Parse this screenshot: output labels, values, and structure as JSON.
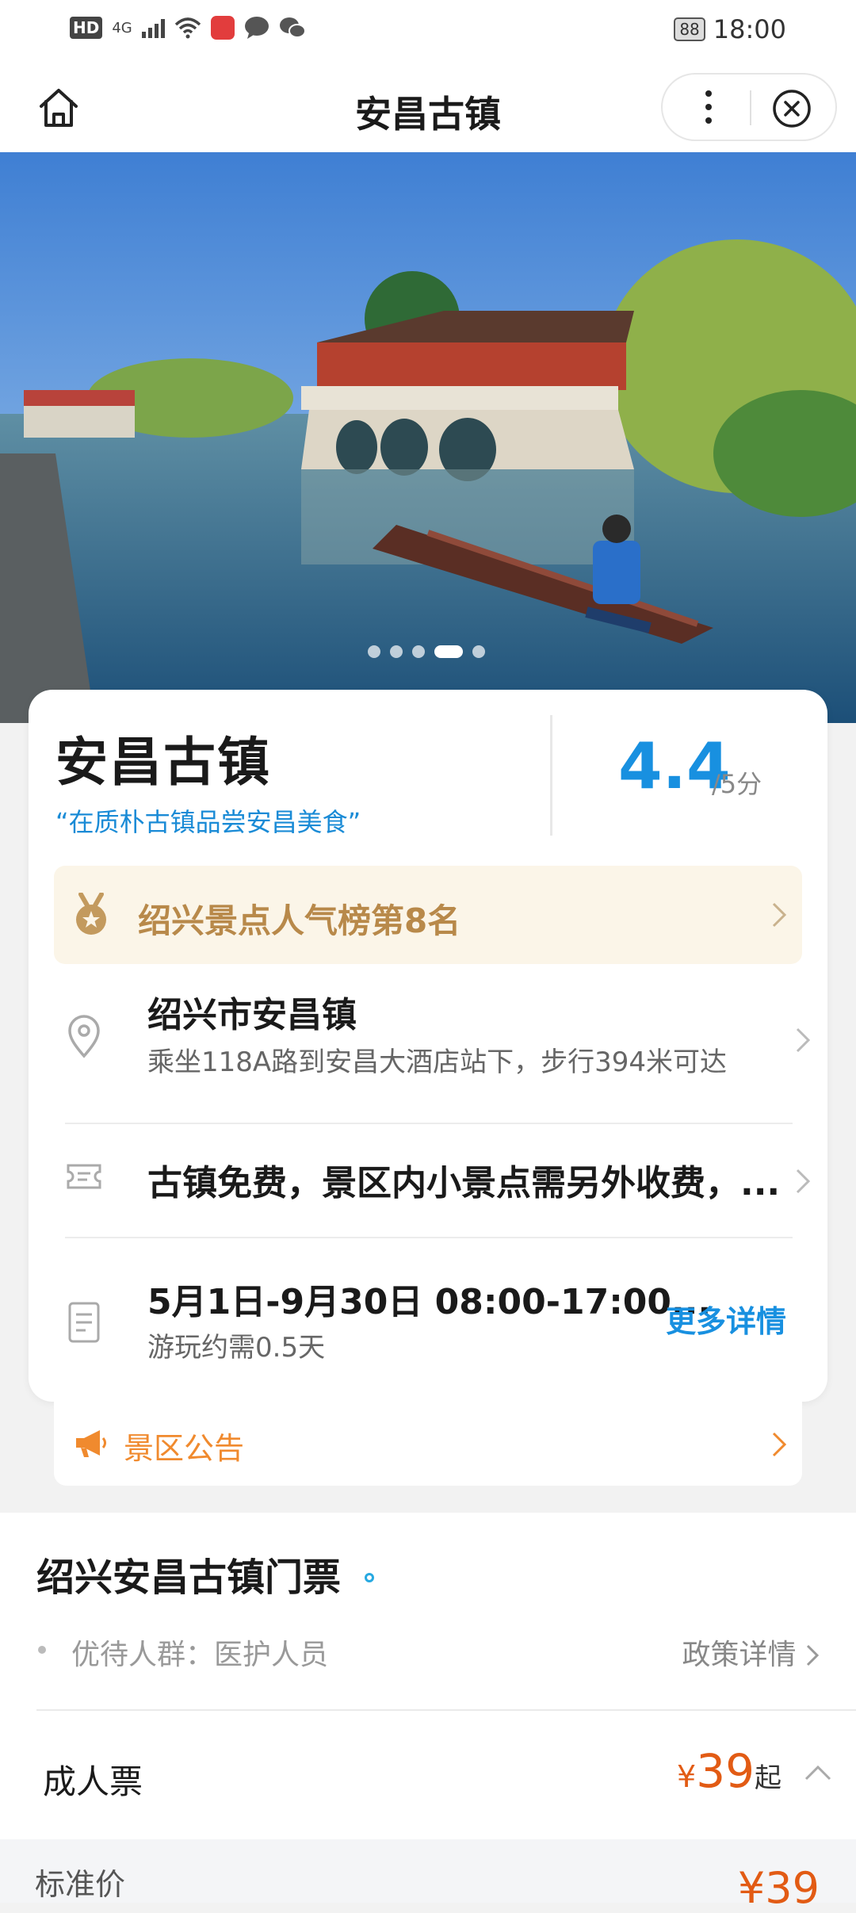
{
  "status_bar": {
    "network_hd": "HD",
    "network_type": "4G",
    "battery": "88",
    "time": "18:00"
  },
  "nav": {
    "title": "安昌古镇",
    "home_icon": "home-icon",
    "more_icon": "more-vertical-icon",
    "close_icon": "close-circle-icon"
  },
  "hero": {
    "slide_count": 5,
    "active_slide": 4
  },
  "attraction": {
    "name": "安昌古镇",
    "slogan": "“在质朴古镇品尝安昌美食”",
    "rating": "4.4",
    "rating_unit": "/5分",
    "rank_text": "绍兴景点人气榜第8名",
    "address_title": "绍兴市安昌镇",
    "address_sub": "乘坐118A路到安昌大酒店站下，步行394米可达",
    "fee_text": "古镇免费，景区内小景点需另外收费，...",
    "hours_title": "5月1日-9月30日 08:00-17:00...",
    "hours_sub": "游玩约需0.5天",
    "more_details": "更多详情"
  },
  "notice": {
    "label": "景区公告"
  },
  "tickets": {
    "title": "绍兴安昌古镇门票",
    "preferential": "优待人群：医护人员",
    "policy_link": "政策详情",
    "adult_label": "成人票",
    "currency": "¥",
    "adult_price": "39",
    "price_suffix": "起",
    "standard_label": "标准价",
    "standard_price": "¥39"
  },
  "colors": {
    "accent_blue": "#1890e0",
    "rank_gold": "#b8894a",
    "notice_orange": "#f08a2e",
    "price_orange": "#e25b14"
  }
}
